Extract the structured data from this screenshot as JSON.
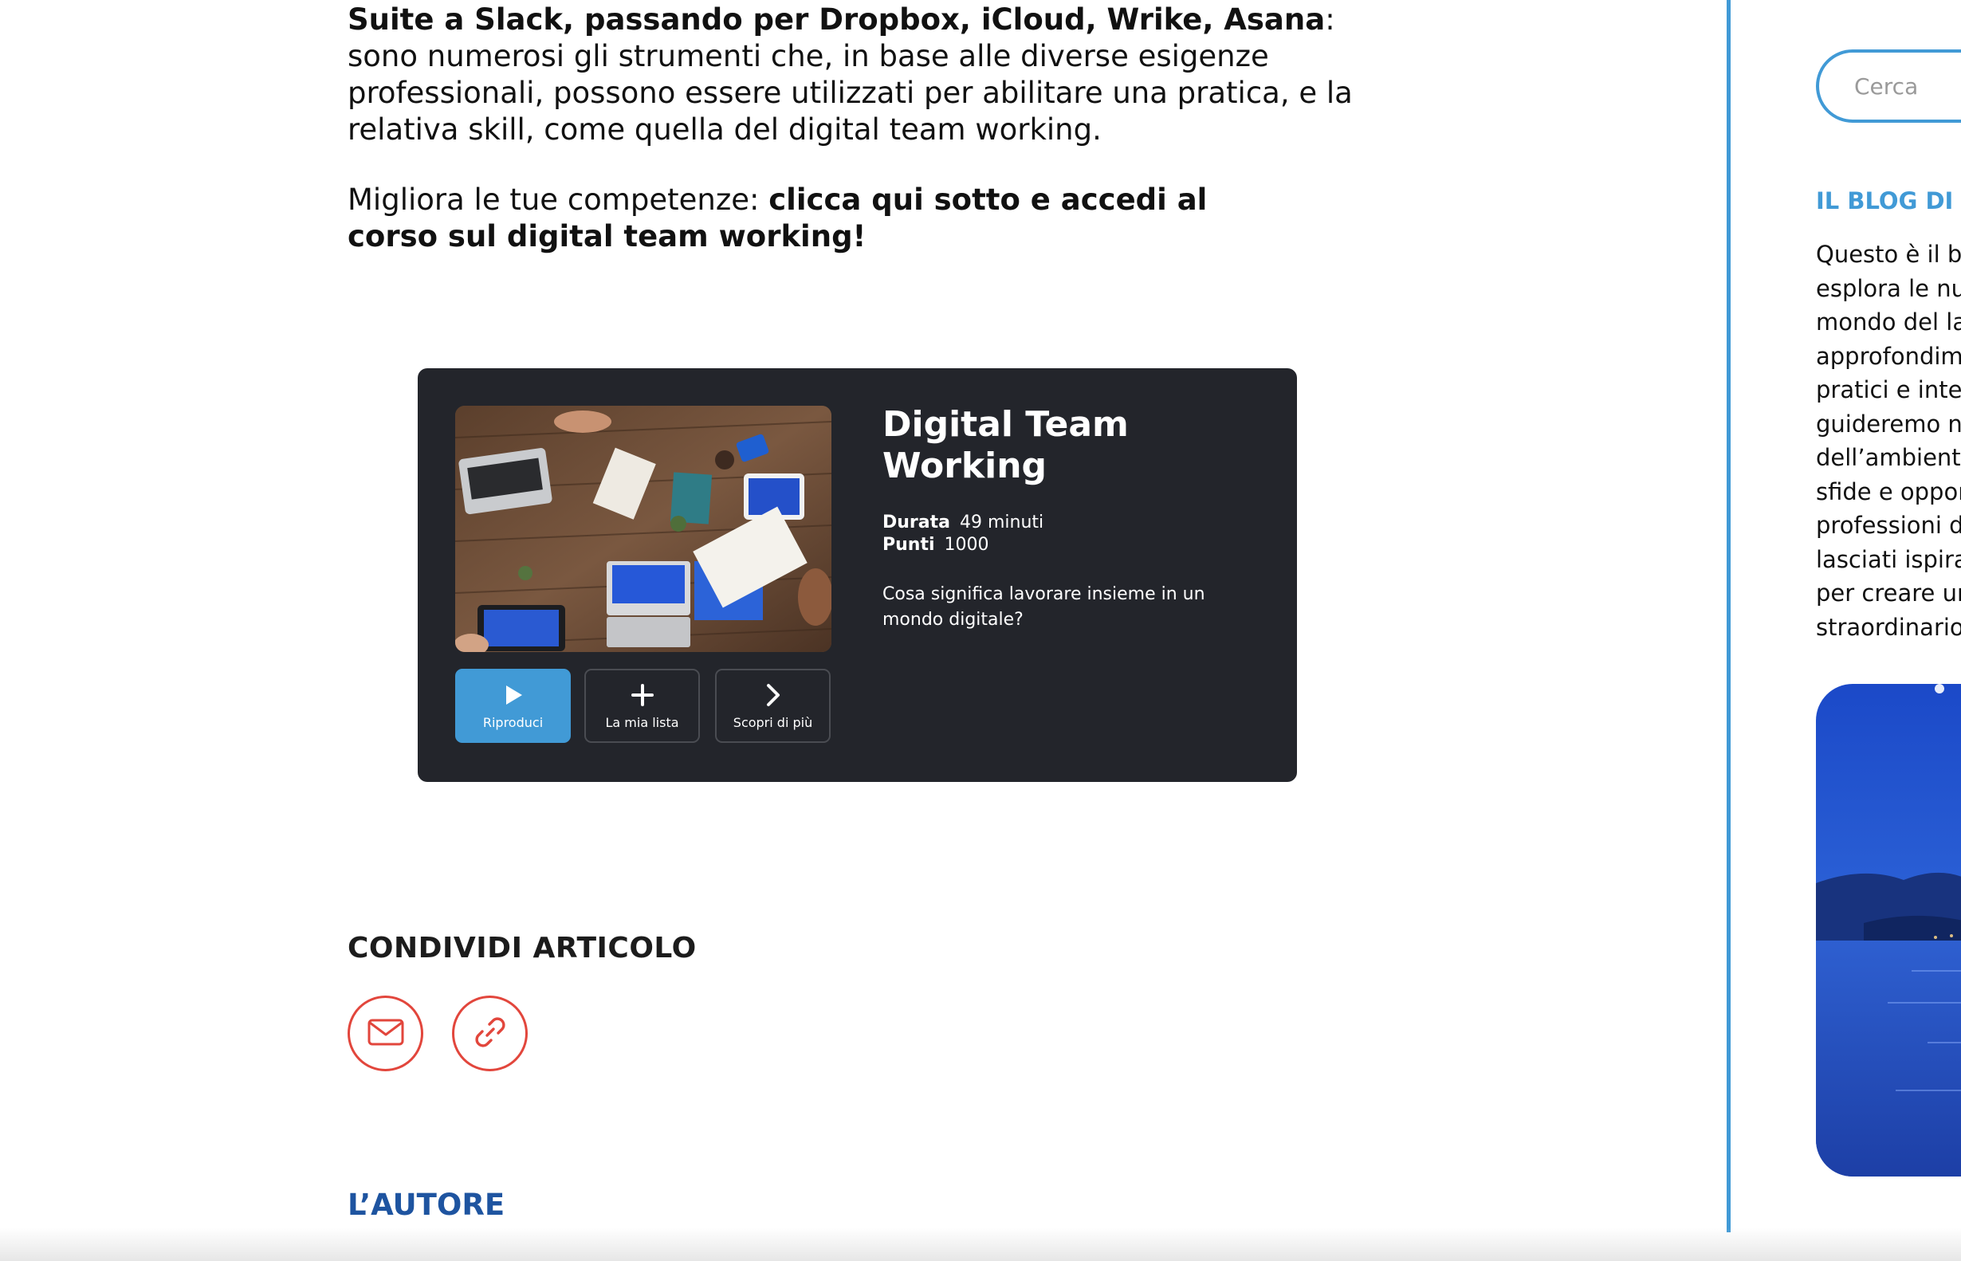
{
  "article": {
    "intro_bold": "Suite a Slack, passando per Dropbox, iCloud, Wrike, Asana",
    "intro_rest": ": sono numerosi gli strumenti che, in base alle diverse esigenze professionali, possono essere utilizzati per abilitare una pratica, e la relativa skill, come quella del digital team working.",
    "cta_plain": "Migliora le tue competenze: ",
    "cta_bold": "clicca qui sotto e accedi al corso sul digital team working!"
  },
  "course": {
    "title": "Digital Team Working",
    "durata_label": "Durata",
    "durata_value": "49 minuti",
    "punti_label": "Punti",
    "punti_value": "1000",
    "description": "Cosa significa lavorare insieme in un mondo digitale?",
    "play_label": "Riproduci",
    "play_icon": "play-icon",
    "list_label": "La mia lista",
    "list_icon": "plus-icon",
    "more_label": "Scopri di più",
    "more_icon": "chevron-right-icon",
    "play_color": "#419ad6",
    "card_color": "#23252b"
  },
  "share": {
    "heading": "CONDIVIDI ARTICOLO",
    "mail_icon": "mail-icon",
    "link_icon": "link-icon",
    "icon_color": "#e2463c"
  },
  "author": {
    "heading": "L’AUTORE"
  },
  "sidebar": {
    "search_placeholder": "Cerca",
    "blog_heading": "IL BLOG DI A",
    "blog_lines": [
      "Questo è il b",
      "esplora le nu",
      "mondo del la",
      "approfondim",
      "pratici e inte",
      "guideremo n",
      "dell’ambiente",
      "sfide e oppor",
      "professioni d",
      "lasciati ispira",
      "per creare ur",
      "straordinario"
    ],
    "accent_color": "#419ad6"
  }
}
